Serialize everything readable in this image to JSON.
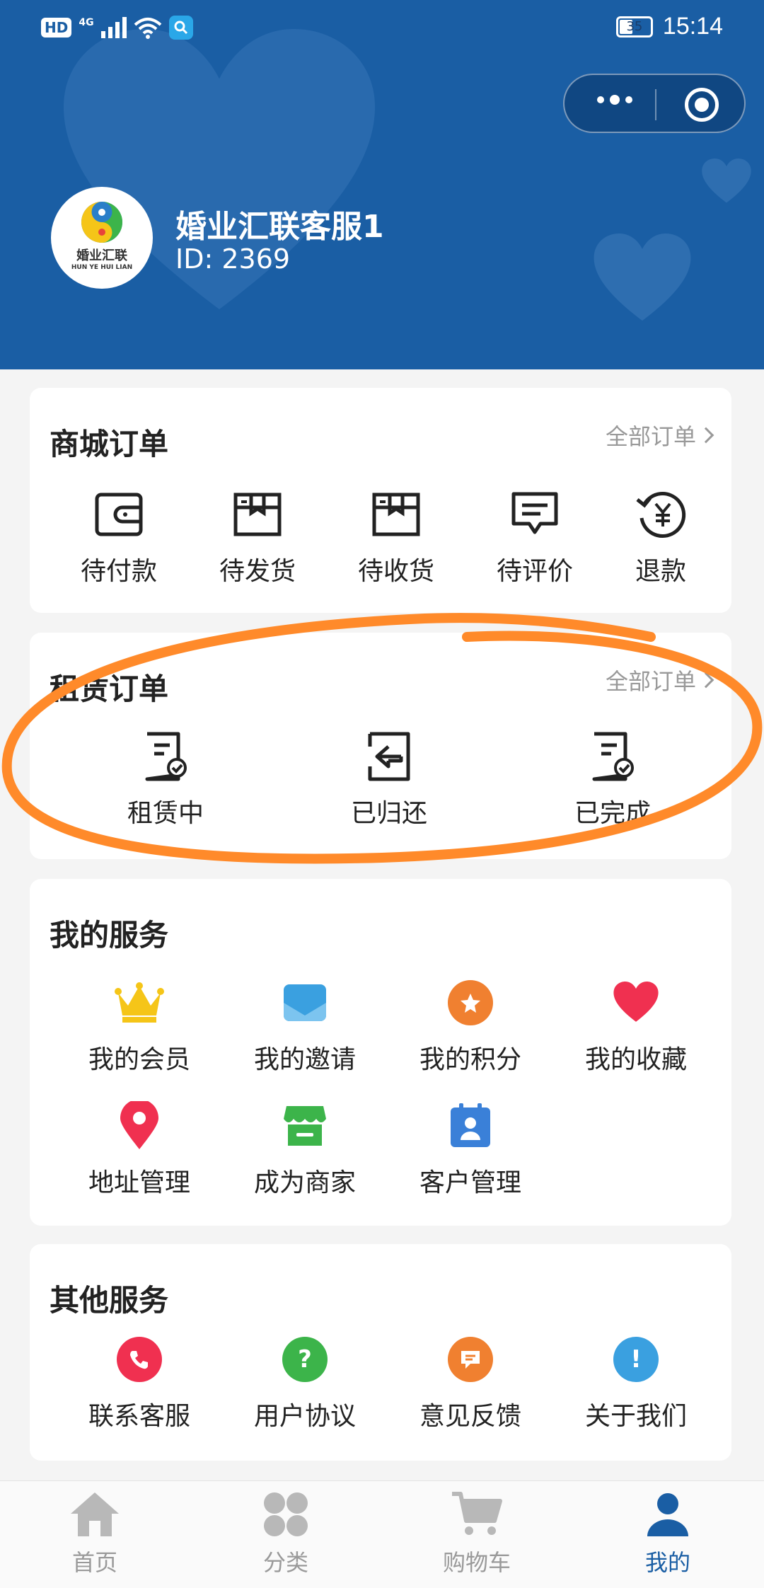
{
  "status_bar": {
    "hd": "HD",
    "network": "4G",
    "battery": "35",
    "time": "15:14"
  },
  "profile": {
    "name": "婚业汇联客服1",
    "id": "ID:  2369",
    "logo_cn": "婚业汇联",
    "logo_en": "HUN YE HUI LIAN"
  },
  "mall_orders": {
    "title": "商城订单",
    "more": "全部订单",
    "items": [
      {
        "label": "待付款",
        "icon": "wallet-icon"
      },
      {
        "label": "待发货",
        "icon": "box-icon"
      },
      {
        "label": "待收货",
        "icon": "box-icon"
      },
      {
        "label": "待评价",
        "icon": "comment-icon"
      },
      {
        "label": "退款",
        "icon": "refund-yen-icon"
      }
    ]
  },
  "rental_orders": {
    "title": "租赁订单",
    "more": "全部订单",
    "items": [
      {
        "label": "租赁中",
        "icon": "doc-check-icon"
      },
      {
        "label": "已归还",
        "icon": "return-icon"
      },
      {
        "label": "已完成",
        "icon": "doc-check-icon"
      }
    ]
  },
  "my_services": {
    "title": "我的服务",
    "items": [
      {
        "label": "我的会员",
        "icon": "crown-icon",
        "color": "#f5c518"
      },
      {
        "label": "我的邀请",
        "icon": "envelope-icon",
        "color": "#3aa0e0"
      },
      {
        "label": "我的积分",
        "icon": "star-icon",
        "color": "#f08030"
      },
      {
        "label": "我的收藏",
        "icon": "heart-icon",
        "color": "#f03050"
      },
      {
        "label": "地址管理",
        "icon": "location-pin-icon",
        "color": "#f03050"
      },
      {
        "label": "成为商家",
        "icon": "shop-icon",
        "color": "#3cb44a"
      },
      {
        "label": "客户管理",
        "icon": "contact-card-icon",
        "color": "#3a80d8"
      }
    ]
  },
  "other_services": {
    "title": "其他服务",
    "items": [
      {
        "label": "联系客服",
        "icon": "phone-icon",
        "color": "#f03050"
      },
      {
        "label": "用户协议",
        "icon": "question-icon",
        "color": "#3cb44a"
      },
      {
        "label": "意见反馈",
        "icon": "feedback-icon",
        "color": "#f08030"
      },
      {
        "label": "关于我们",
        "icon": "info-icon",
        "color": "#3aa0e0"
      }
    ]
  },
  "tabbar": {
    "items": [
      {
        "label": "首页",
        "icon": "home-icon"
      },
      {
        "label": "分类",
        "icon": "category-icon"
      },
      {
        "label": "购物车",
        "icon": "cart-icon"
      },
      {
        "label": "我的",
        "icon": "profile-icon"
      }
    ],
    "active_index": 3,
    "active_color": "#1a5ea4",
    "inactive_color": "#b8b8b8"
  },
  "colors": {
    "header_bg": "#1a5ea4",
    "annotation": "#ff8a2a"
  }
}
